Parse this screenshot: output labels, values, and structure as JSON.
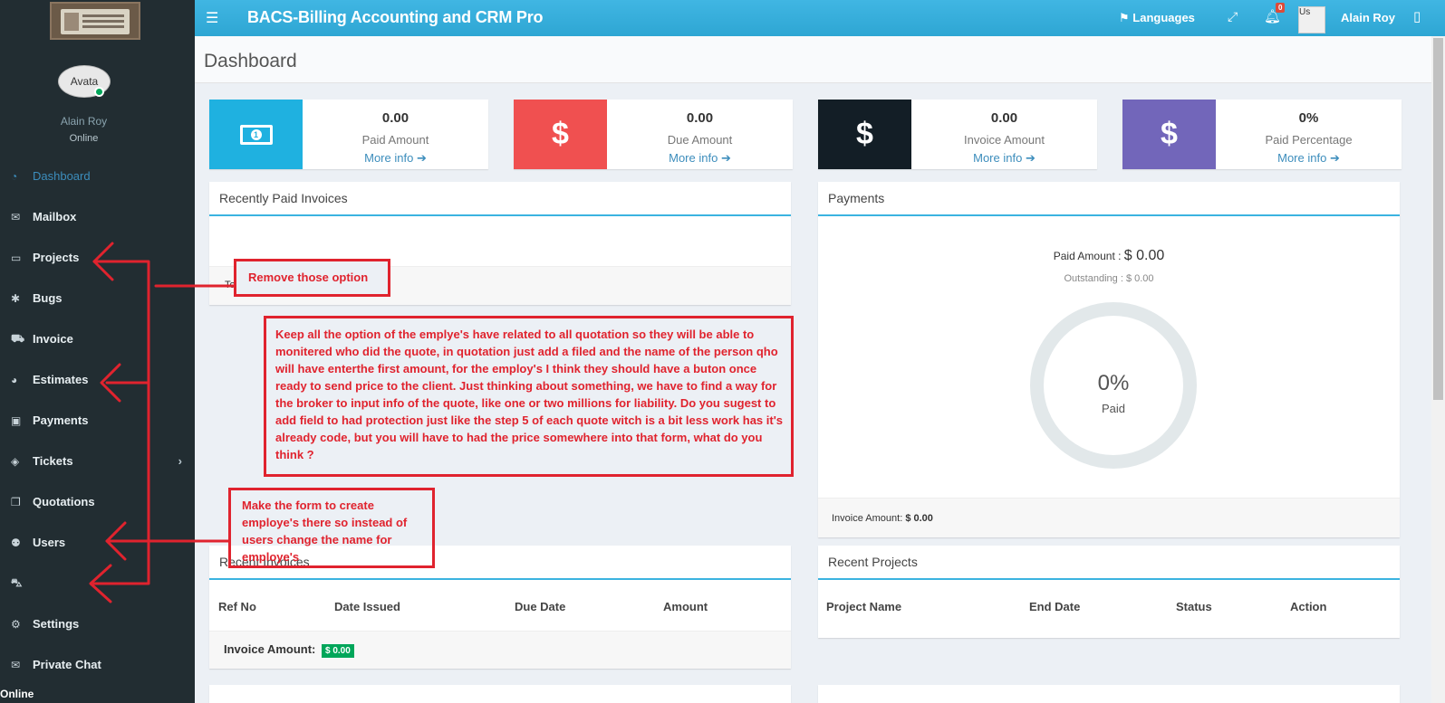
{
  "app": {
    "title": "BACS-Billing Accounting and CRM Pro",
    "page_title": "Dashboard"
  },
  "header": {
    "languages_label": "Languages",
    "notification_count": "0",
    "user_img_alt": "Us",
    "user_name": "Alain Roy"
  },
  "sidebar": {
    "avatar_alt": "Avata",
    "user_name": "Alain Roy",
    "user_status": "Online",
    "footer_status": "Online",
    "items": [
      {
        "label": "Dashboard",
        "icon": "dashboard-icon"
      },
      {
        "label": "Mailbox",
        "icon": "envelope-icon"
      },
      {
        "label": "Projects",
        "icon": "folder-open-icon"
      },
      {
        "label": "Bugs",
        "icon": "bug-icon"
      },
      {
        "label": "Invoice",
        "icon": "cart-icon"
      },
      {
        "label": "Estimates",
        "icon": "palette-icon"
      },
      {
        "label": "Payments",
        "icon": "money-icon"
      },
      {
        "label": "Tickets",
        "icon": "ticket-icon"
      },
      {
        "label": "Quotations",
        "icon": "copy-icon"
      },
      {
        "label": "Users",
        "icon": "users-icon"
      },
      {
        "label": "",
        "icon": "car-icon"
      },
      {
        "label": "Settings",
        "icon": "cogs-icon"
      },
      {
        "label": "Private Chat",
        "icon": "envelope-icon"
      }
    ]
  },
  "info_boxes": [
    {
      "value": "0.00",
      "label": "Paid Amount",
      "link": "More info",
      "color": "#1fb1e0",
      "icon": "money-bill-icon"
    },
    {
      "value": "0.00",
      "label": "Due Amount",
      "link": "More info",
      "color": "#f05050",
      "icon": "dollar-icon"
    },
    {
      "value": "0.00",
      "label": "Invoice Amount",
      "link": "More info",
      "color": "#131e26",
      "icon": "dollar-icon"
    },
    {
      "value": "0%",
      "label": "Paid Percentage",
      "link": "More info",
      "color": "#7266ba",
      "icon": "dollar-icon"
    }
  ],
  "recently_paid": {
    "title": "Recently Paid Invoices",
    "footer": "Total Receipts: $ 0.00"
  },
  "payments": {
    "title": "Payments",
    "paid_label": "Paid Amount : ",
    "paid_value": "$ 0.00",
    "outstanding": "Outstanding : $ 0.00",
    "percent": "0%",
    "percent_value": 0,
    "percent_label": "Paid",
    "footer_label": "Invoice Amount: ",
    "footer_value": "$ 0.00"
  },
  "recent_invoices": {
    "title": "Recent Invoices",
    "columns": [
      "Ref No",
      "Date Issued",
      "Due Date",
      "Amount"
    ],
    "footer_label": "Invoice Amount:",
    "footer_value": "$ 0.00"
  },
  "recent_projects": {
    "title": "Recent Projects",
    "columns": [
      "Project Name",
      "End Date",
      "Status",
      "Action"
    ]
  },
  "annotations": {
    "remove": "Remove those option",
    "keep": "Keep all the option of the emplye's have related to all quotation so they will be able to monitered who did the quote, in quotation just add a filed and the name of the person qho will have enterthe first amount, for the employ's I think they should have a buton once ready to send price to the client. Just thinking about something, we have to find a way for the broker to input info of the quote, like one or two millions for liability. Do you sugest to add field to had protection just like the step 5 of each quote witch is  a bit less work has it's already code, but you will have to had the price somewhere into that form, what do you think ?",
    "employes": "Make the form to create employe's there so instead of users change the name for employe's",
    "color": "#e0232e"
  }
}
